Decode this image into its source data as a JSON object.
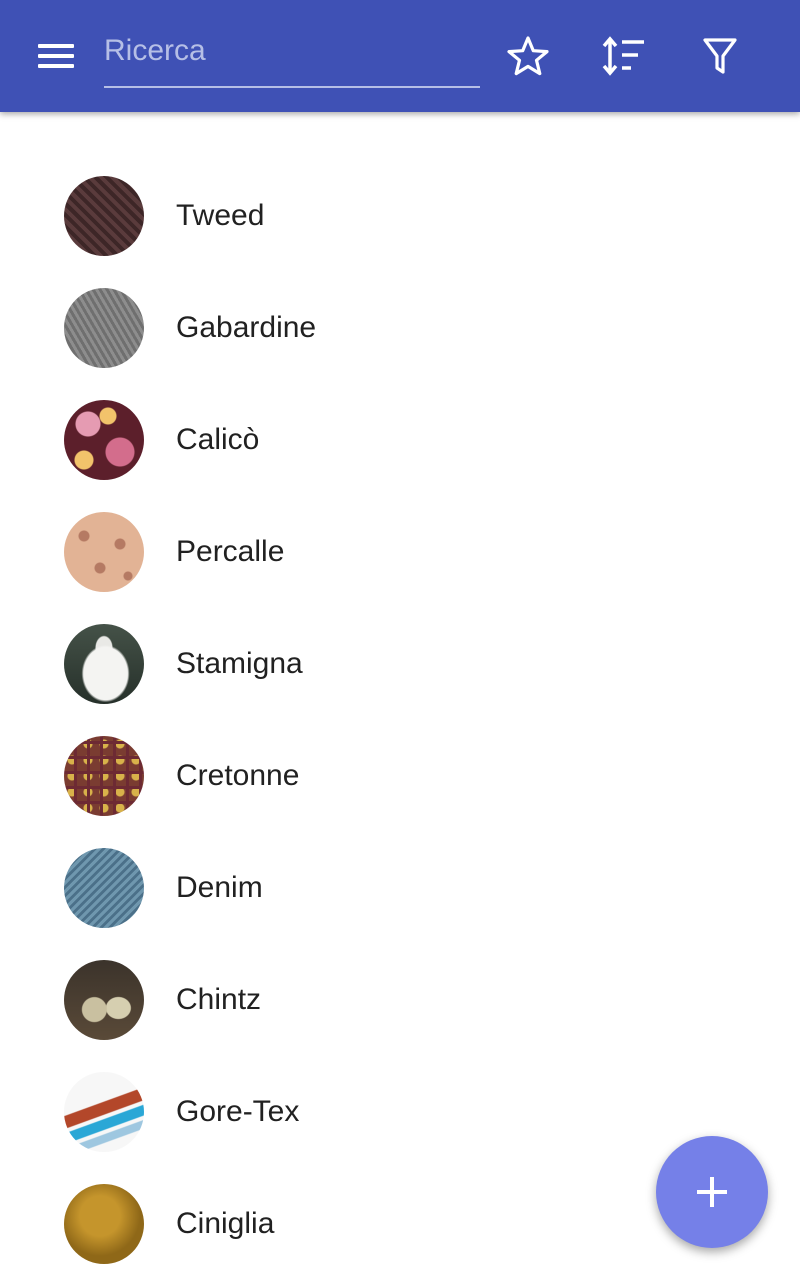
{
  "app_bar": {
    "search_placeholder": "Ricerca",
    "background_color": "#3f51b5",
    "icons": [
      "menu-icon",
      "star-icon",
      "sort-icon",
      "filter-icon"
    ]
  },
  "list": {
    "items": [
      {
        "label": "Tweed"
      },
      {
        "label": "Gabardine"
      },
      {
        "label": "Calicò"
      },
      {
        "label": "Percalle"
      },
      {
        "label": "Stamigna"
      },
      {
        "label": "Cretonne"
      },
      {
        "label": "Denim"
      },
      {
        "label": "Chintz"
      },
      {
        "label": "Gore-Tex"
      },
      {
        "label": "Ciniglia"
      }
    ]
  },
  "fab": {
    "icon": "plus-icon",
    "color": "#7580e8"
  }
}
